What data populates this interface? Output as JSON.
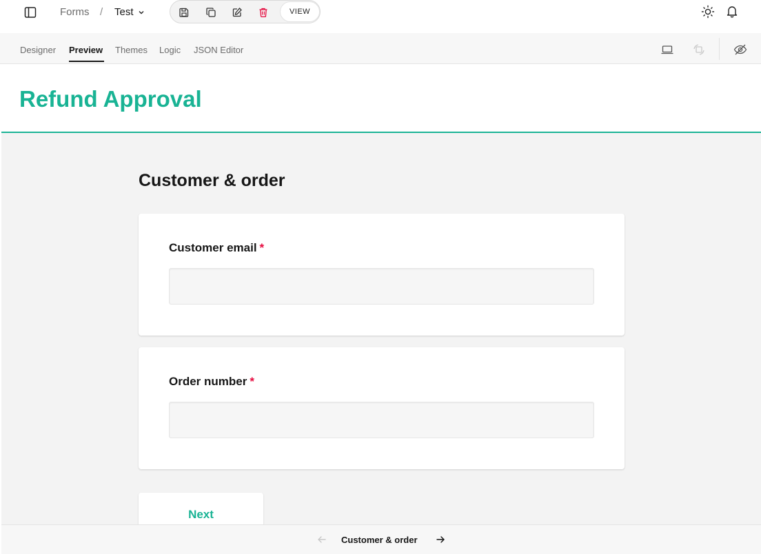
{
  "topbar": {
    "breadcrumb": {
      "root": "Forms",
      "separator": "/",
      "current": "Test"
    },
    "toolbar": {
      "icons": [
        "save-icon",
        "copy-icon",
        "edit-icon",
        "trash-icon"
      ],
      "view_label": "VIEW"
    },
    "right_icons": [
      "sun-icon",
      "bell-icon"
    ]
  },
  "tabs": [
    {
      "label": "Designer",
      "active": false
    },
    {
      "label": "Preview",
      "active": true
    },
    {
      "label": "Themes",
      "active": false
    },
    {
      "label": "Logic",
      "active": false
    },
    {
      "label": "JSON Editor",
      "active": false
    }
  ],
  "tab_tools": [
    "laptop-icon",
    "rotate-device-icon",
    "eye-off-icon"
  ],
  "form": {
    "title": "Refund Approval",
    "page_title": "Customer & order",
    "questions": [
      {
        "label": "Customer email",
        "required_mark": "*",
        "value": ""
      },
      {
        "label": "Order number",
        "required_mark": "*",
        "value": ""
      }
    ],
    "next_label": "Next"
  },
  "footer": {
    "page_label": "Customer & order"
  },
  "colors": {
    "accent": "#19b394",
    "required": "#e60a3e",
    "danger": "#e50a3e"
  }
}
